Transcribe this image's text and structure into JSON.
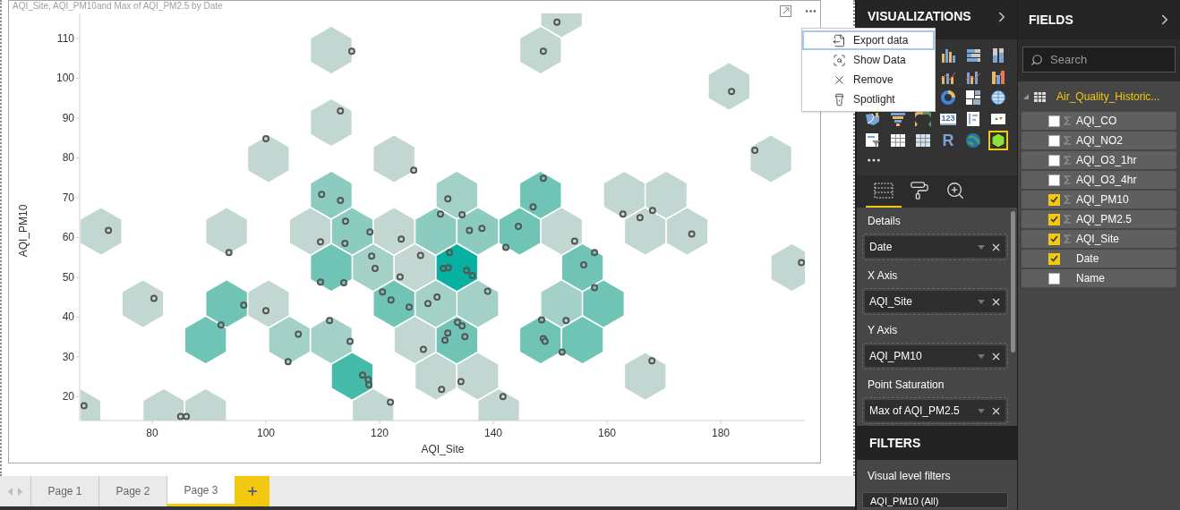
{
  "visual": {
    "title": "AQI_Site, AQI_PM10and Max of AQI_PM2.5 by Date",
    "chart_data": {
      "type": "scatter",
      "xlabel": "AQI_Site",
      "ylabel": "AQI_PM10",
      "xlim": [
        67.4,
        194.8
      ],
      "ylim": [
        14,
        116.3
      ],
      "xticks": [
        80,
        100,
        120,
        140,
        160,
        180
      ],
      "yticks": [
        20,
        30,
        40,
        50,
        60,
        70,
        80,
        90,
        100,
        110
      ],
      "x": [
        151.2,
        115.1,
        148.8,
        181.9,
        113.1,
        100.0,
        186.0,
        126.0,
        162.8,
        165.8,
        168.0,
        72.3,
        123.8,
        109.6,
        154.3,
        174.9,
        93.5,
        127.2,
        194.2,
        123.6,
        80.3,
        100.0,
        127.7,
        167.9,
        130.9,
        134.3,
        68.0,
        121.9,
        141.7,
        85.0,
        86.0,
        132.0,
        134.5,
        118.6,
        119.2,
        139.0,
        130.1,
        128.5,
        111.2,
        152.8,
        105.7,
        114.8,
        103.9,
        109.8,
        113.1,
        114.0,
        130.7,
        138.0,
        135.8,
        118.3,
        113.9,
        148.8,
        147.0,
        144.4,
        142.2,
        157.8,
        155.9,
        109.6,
        113.7,
        157.8,
        120.5,
        122.0,
        96.1,
        125.2,
        148.5,
        92.1,
        133.7,
        134.5,
        132.0,
        135.0,
        131.5,
        148.8,
        149.1,
        152.1,
        117.0,
        118.0,
        118.1,
        132.3,
        132.1,
        131.2,
        135.3,
        136.3
      ],
      "series": [
        {
          "color": "#c2d6d2",
          "values": [
            114.1,
            106.8,
            106.8,
            96.7,
            91.8,
            84.8,
            81.9,
            76.9,
            65.9,
            65.0,
            66.8,
            61.8,
            59.6,
            58.9,
            59.1,
            60.9,
            56.2,
            55.5,
            53.7,
            50.1,
            44.7,
            41.6,
            31.9,
            29.0,
            21.8,
            23.8,
            17.7,
            18.6,
            20.0,
            15.0,
            15.0,
            null,
            null,
            null,
            null,
            null,
            null,
            null,
            null,
            null,
            null,
            null,
            null,
            null,
            null,
            null,
            null,
            null,
            null,
            null,
            null,
            null,
            null,
            null,
            null,
            null,
            null,
            null,
            null,
            null,
            null,
            null,
            null,
            null,
            null,
            null,
            null,
            null,
            null,
            null,
            null,
            null,
            null,
            null,
            null,
            null,
            null,
            null,
            null,
            null,
            null,
            null
          ]
        },
        {
          "color": "#a3d1c8",
          "values": [
            null,
            null,
            null,
            null,
            null,
            null,
            null,
            null,
            null,
            null,
            null,
            null,
            null,
            null,
            null,
            null,
            null,
            null,
            null,
            null,
            null,
            null,
            null,
            null,
            null,
            null,
            null,
            null,
            null,
            null,
            null,
            69.7,
            65.7,
            55.3,
            52.2,
            46.5,
            45.0,
            43.4,
            39.1,
            39.1,
            35.7,
            33.9,
            28.8,
            null,
            null,
            null,
            null,
            null,
            null,
            null,
            null,
            null,
            null,
            null,
            null,
            null,
            null,
            null,
            null,
            null,
            null,
            null,
            null,
            null,
            null,
            null,
            null,
            null,
            null,
            null,
            null,
            null,
            null,
            null,
            null,
            null,
            null,
            null,
            null,
            null,
            null,
            null
          ]
        },
        {
          "color": "#8ccbbf",
          "values": [
            null,
            null,
            null,
            null,
            null,
            null,
            null,
            null,
            null,
            null,
            null,
            null,
            null,
            null,
            null,
            null,
            null,
            null,
            null,
            null,
            null,
            null,
            null,
            null,
            null,
            null,
            null,
            null,
            null,
            null,
            null,
            null,
            null,
            null,
            null,
            null,
            null,
            null,
            null,
            null,
            null,
            null,
            null,
            70.8,
            69.3,
            64.1,
            65.9,
            62.3,
            61.8,
            61.4,
            58.5,
            null,
            null,
            null,
            null,
            null,
            null,
            null,
            null,
            null,
            null,
            null,
            null,
            null,
            null,
            null,
            null,
            null,
            null,
            null,
            null,
            null,
            null,
            null,
            null,
            null,
            null,
            null,
            null,
            null,
            null,
            null
          ]
        },
        {
          "color": "#6fc4b5",
          "values": [
            null,
            null,
            null,
            null,
            null,
            null,
            null,
            null,
            null,
            null,
            null,
            null,
            null,
            null,
            null,
            null,
            null,
            null,
            null,
            null,
            null,
            null,
            null,
            null,
            null,
            null,
            null,
            null,
            null,
            null,
            null,
            null,
            null,
            null,
            null,
            null,
            null,
            null,
            null,
            null,
            null,
            null,
            null,
            null,
            null,
            null,
            null,
            null,
            null,
            null,
            null,
            74.9,
            67.7,
            62.8,
            57.5,
            56.2,
            53.1,
            48.8,
            48.6,
            47.4,
            46.3,
            44.3,
            43.0,
            42.5,
            39.3,
            38.0,
            38.7,
            37.8,
            36.0,
            35.1,
            34.2,
            34.6,
            33.9,
            31.2,
            null,
            null,
            null,
            null,
            null,
            null,
            null,
            null
          ]
        },
        {
          "color": "#45baa9",
          "values": [
            null,
            null,
            null,
            null,
            null,
            null,
            null,
            null,
            null,
            null,
            null,
            null,
            null,
            null,
            null,
            null,
            null,
            null,
            null,
            null,
            null,
            null,
            null,
            null,
            null,
            null,
            null,
            null,
            null,
            null,
            null,
            null,
            null,
            null,
            null,
            null,
            null,
            null,
            null,
            null,
            null,
            null,
            null,
            null,
            null,
            null,
            null,
            null,
            null,
            null,
            null,
            null,
            null,
            null,
            null,
            null,
            null,
            null,
            null,
            null,
            null,
            null,
            null,
            null,
            null,
            null,
            null,
            null,
            null,
            null,
            null,
            null,
            null,
            null,
            25.4,
            24.3,
            23.0,
            null,
            null,
            null,
            null,
            null
          ]
        },
        {
          "color": "#07b1a2",
          "values": [
            null,
            null,
            null,
            null,
            null,
            null,
            null,
            null,
            null,
            null,
            null,
            null,
            null,
            null,
            null,
            null,
            null,
            null,
            null,
            null,
            null,
            null,
            null,
            null,
            null,
            null,
            null,
            null,
            null,
            null,
            null,
            null,
            null,
            null,
            null,
            null,
            null,
            null,
            null,
            null,
            null,
            null,
            null,
            null,
            null,
            null,
            null,
            null,
            null,
            null,
            null,
            null,
            null,
            null,
            null,
            null,
            null,
            null,
            null,
            null,
            null,
            null,
            null,
            null,
            null,
            null,
            null,
            null,
            null,
            null,
            null,
            null,
            null,
            null,
            null,
            null,
            null,
            56.2,
            52.4,
            52.2,
            51.7,
            50.4
          ]
        }
      ]
    },
    "menu": [
      {
        "label": "Export data",
        "kind": "export",
        "selected": true
      },
      {
        "label": "Show Data",
        "kind": "show",
        "selected": false
      },
      {
        "label": "Remove",
        "kind": "remove",
        "selected": false
      },
      {
        "label": "Spotlight",
        "kind": "spotlight",
        "selected": false
      }
    ]
  },
  "page_tabs": [
    {
      "label": "Page 1",
      "selected": false
    },
    {
      "label": "Page 2",
      "selected": false
    },
    {
      "label": "Page 3",
      "selected": true
    }
  ],
  "visualizations": {
    "title": "VISUALIZATIONS",
    "icon_rows": [
      [
        {
          "kind": "column",
          "selected": false
        },
        {
          "kind": "bar100",
          "selected": false
        },
        {
          "kind": "column100",
          "selected": false
        }
      ],
      [
        {
          "kind": "linecolumn",
          "selected": false
        },
        {
          "kind": "linecolumn2",
          "selected": false
        },
        {
          "kind": "ribbon",
          "selected": false
        }
      ],
      [
        {
          "kind": "donut",
          "selected": false
        },
        {
          "kind": "treemap",
          "selected": false
        },
        {
          "kind": "globe",
          "selected": false
        }
      ],
      [
        {
          "kind": "filledmap",
          "selected": false
        },
        {
          "kind": "funnel",
          "selected": false
        },
        {
          "kind": "gauge",
          "selected": false
        },
        {
          "kind": "card",
          "label": "123",
          "selected": false
        },
        {
          "kind": "multicard",
          "selected": false
        },
        {
          "kind": "kpi",
          "selected": false
        }
      ],
      [
        {
          "kind": "slicer",
          "selected": false
        },
        {
          "kind": "table",
          "selected": false
        },
        {
          "kind": "matrix",
          "selected": false
        },
        {
          "kind": "rscript",
          "label": "R",
          "selected": false
        },
        {
          "kind": "globemap",
          "selected": false
        },
        {
          "kind": "hexbin",
          "selected": true
        }
      ]
    ],
    "pane_tabs": [
      {
        "kind": "fields",
        "selected": true
      },
      {
        "kind": "format",
        "selected": false
      },
      {
        "kind": "analytics",
        "selected": false
      }
    ],
    "wells": [
      {
        "label": "Details",
        "value": "Date"
      },
      {
        "label": "X Axis",
        "value": "AQI_Site"
      },
      {
        "label": "Y Axis",
        "value": "AQI_PM10"
      },
      {
        "label": "Point Saturation",
        "value": "Max of AQI_PM2.5"
      }
    ]
  },
  "filters": {
    "title": "FILTERS",
    "section": "Visual level filters",
    "items": [
      "AQI_PM10 (All)"
    ]
  },
  "fields": {
    "title": "FIELDS",
    "search": {
      "placeholder": "Search"
    },
    "table": {
      "name": "Air_Quality_Historic...",
      "expanded": true,
      "fields": [
        {
          "name": "AQI_CO",
          "kind": "measure",
          "checked": false
        },
        {
          "name": "AQI_NO2",
          "kind": "measure",
          "checked": false
        },
        {
          "name": "AQI_O3_1hr",
          "kind": "measure",
          "checked": false
        },
        {
          "name": "AQI_O3_4hr",
          "kind": "measure",
          "checked": false
        },
        {
          "name": "AQI_PM10",
          "kind": "measure",
          "checked": true
        },
        {
          "name": "AQI_PM2.5",
          "kind": "measure",
          "checked": true
        },
        {
          "name": "AQI_Site",
          "kind": "measure",
          "checked": true
        },
        {
          "name": "Date",
          "kind": "attribute",
          "checked": true
        },
        {
          "name": "Name",
          "kind": "attribute",
          "checked": false
        }
      ]
    }
  }
}
